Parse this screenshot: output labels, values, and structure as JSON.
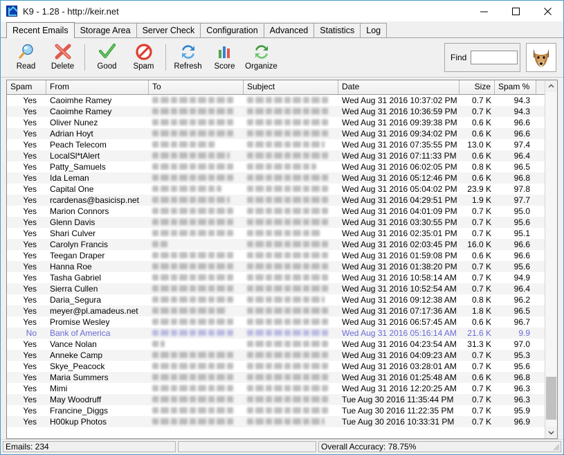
{
  "window": {
    "title": "K9 - 1.28 - http://keir.net",
    "icon": "k9-app-icon",
    "minimize_label": "Minimize",
    "maximize_label": "Maximize",
    "close_label": "Close"
  },
  "tabs": [
    {
      "label": "Recent Emails",
      "active": true
    },
    {
      "label": "Storage Area",
      "active": false
    },
    {
      "label": "Server Check",
      "active": false
    },
    {
      "label": "Configuration",
      "active": false
    },
    {
      "label": "Advanced",
      "active": false
    },
    {
      "label": "Statistics",
      "active": false
    },
    {
      "label": "Log",
      "active": false
    }
  ],
  "toolbar": {
    "buttons": [
      {
        "label": "Read",
        "icon": "magnifier-icon"
      },
      {
        "label": "Delete",
        "icon": "red-x-icon"
      },
      {
        "label": "Good",
        "icon": "green-check-icon"
      },
      {
        "label": "Spam",
        "icon": "no-entry-icon"
      },
      {
        "label": "Refresh",
        "icon": "blue-refresh-icon"
      },
      {
        "label": "Score",
        "icon": "bar-chart-icon"
      },
      {
        "label": "Organize",
        "icon": "green-refresh-icon"
      }
    ],
    "find_label": "Find",
    "find_value": "",
    "find_placeholder": "",
    "mascot_icon": "fox-head-icon"
  },
  "table": {
    "columns": [
      "Spam",
      "From",
      "To",
      "Subject",
      "Date",
      "Size",
      "Spam %"
    ],
    "rows": [
      {
        "spam": "Yes",
        "from": "Caoimhe Ramey",
        "to": "",
        "subject": "",
        "date": "Wed Aug 31 2016  10:37:02 PM",
        "size": "0.7 K",
        "pct": "94.3",
        "selected": false
      },
      {
        "spam": "Yes",
        "from": "Caoimhe Ramey",
        "to": "",
        "subject": "",
        "date": "Wed Aug 31 2016  10:36:59 PM",
        "size": "0.7 K",
        "pct": "94.3",
        "selected": false
      },
      {
        "spam": "Yes",
        "from": "Oliver Nunez",
        "to": "",
        "subject": "",
        "date": "Wed Aug 31 2016  09:39:38 PM",
        "size": "0.6 K",
        "pct": "96.6",
        "selected": false
      },
      {
        "spam": "Yes",
        "from": "Adrian Hoyt",
        "to": "",
        "subject": "",
        "date": "Wed Aug 31 2016  09:34:02 PM",
        "size": "0.6 K",
        "pct": "96.6",
        "selected": false
      },
      {
        "spam": "Yes",
        "from": "Peach Telecom",
        "to": "",
        "subject": "",
        "date": "Wed Aug 31 2016  07:35:55 PM",
        "size": "13.0 K",
        "pct": "97.4",
        "selected": false
      },
      {
        "spam": "Yes",
        "from": "LocalSl*tAlert",
        "to": "",
        "subject": "",
        "date": "Wed Aug 31 2016  07:11:33 PM",
        "size": "0.6 K",
        "pct": "96.4",
        "selected": false
      },
      {
        "spam": "Yes",
        "from": "Patty_Samuels",
        "to": "",
        "subject": "",
        "date": "Wed Aug 31 2016  06:02:05 PM",
        "size": "0.8 K",
        "pct": "96.5",
        "selected": false
      },
      {
        "spam": "Yes",
        "from": "Ida Leman",
        "to": "",
        "subject": "",
        "date": "Wed Aug 31 2016  05:12:46 PM",
        "size": "0.6 K",
        "pct": "96.8",
        "selected": false
      },
      {
        "spam": "Yes",
        "from": "Capital One",
        "to": "",
        "subject": "",
        "date": "Wed Aug 31 2016  05:04:02 PM",
        "size": "23.9 K",
        "pct": "97.8",
        "selected": false
      },
      {
        "spam": "Yes",
        "from": "rcardenas@basicisp.net",
        "to": "",
        "subject": "",
        "date": "Wed Aug 31 2016  04:29:51 PM",
        "size": "1.9 K",
        "pct": "97.7",
        "selected": false
      },
      {
        "spam": "Yes",
        "from": "Marion Connors",
        "to": "",
        "subject": "",
        "date": "Wed Aug 31 2016  04:01:09 PM",
        "size": "0.7 K",
        "pct": "95.0",
        "selected": false
      },
      {
        "spam": "Yes",
        "from": "Glenn Davis",
        "to": "",
        "subject": "",
        "date": "Wed Aug 31 2016  03:30:55 PM",
        "size": "0.7 K",
        "pct": "95.6",
        "selected": false
      },
      {
        "spam": "Yes",
        "from": "Shari Culver",
        "to": "",
        "subject": "",
        "date": "Wed Aug 31 2016  02:35:01 PM",
        "size": "0.7 K",
        "pct": "95.1",
        "selected": false
      },
      {
        "spam": "Yes",
        "from": "Carolyn Francis",
        "to": "",
        "subject": "",
        "date": "Wed Aug 31 2016  02:03:45 PM",
        "size": "16.0 K",
        "pct": "96.6",
        "selected": false
      },
      {
        "spam": "Yes",
        "from": "Teegan Draper",
        "to": "",
        "subject": "",
        "date": "Wed Aug 31 2016  01:59:08 PM",
        "size": "0.6 K",
        "pct": "96.6",
        "selected": false
      },
      {
        "spam": "Yes",
        "from": "Hanna Roe",
        "to": "",
        "subject": "",
        "date": "Wed Aug 31 2016  01:38:20 PM",
        "size": "0.7 K",
        "pct": "95.6",
        "selected": false
      },
      {
        "spam": "Yes",
        "from": "Tasha Gabriel",
        "to": "",
        "subject": "",
        "date": "Wed Aug 31 2016  10:58:14 AM",
        "size": "0.7 K",
        "pct": "94.9",
        "selected": false
      },
      {
        "spam": "Yes",
        "from": "Sierra Cullen",
        "to": "",
        "subject": "",
        "date": "Wed Aug 31 2016  10:52:54 AM",
        "size": "0.7 K",
        "pct": "96.4",
        "selected": false
      },
      {
        "spam": "Yes",
        "from": "Daria_Segura",
        "to": "",
        "subject": "",
        "date": "Wed Aug 31 2016  09:12:38 AM",
        "size": "0.8 K",
        "pct": "96.2",
        "selected": false
      },
      {
        "spam": "Yes",
        "from": "meyer@pl.amadeus.net",
        "to": "",
        "subject": "",
        "date": "Wed Aug 31 2016  07:17:36 AM",
        "size": "1.8 K",
        "pct": "96.5",
        "selected": false
      },
      {
        "spam": "Yes",
        "from": "Promise Wesley",
        "to": "",
        "subject": "",
        "date": "Wed Aug 31 2016  06:57:45 AM",
        "size": "0.6 K",
        "pct": "96.7",
        "selected": false
      },
      {
        "spam": "No",
        "from": "Bank of America",
        "to": "",
        "subject": "",
        "date": "Wed Aug 31 2016  05:16:14 AM",
        "size": "21.6 K",
        "pct": "9.9",
        "selected": true
      },
      {
        "spam": "Yes",
        "from": "Vance Nolan",
        "to": "",
        "subject": "",
        "date": "Wed Aug 31 2016  04:23:54 AM",
        "size": "31.3 K",
        "pct": "97.0",
        "selected": false
      },
      {
        "spam": "Yes",
        "from": "Anneke Camp",
        "to": "",
        "subject": "",
        "date": "Wed Aug 31 2016  04:09:23 AM",
        "size": "0.7 K",
        "pct": "95.3",
        "selected": false
      },
      {
        "spam": "Yes",
        "from": "Skye_Peacock",
        "to": "",
        "subject": "",
        "date": "Wed Aug 31 2016  03:28:01 AM",
        "size": "0.7 K",
        "pct": "95.6",
        "selected": false
      },
      {
        "spam": "Yes",
        "from": "Maria Summers",
        "to": "",
        "subject": "",
        "date": "Wed Aug 31 2016  01:25:48 AM",
        "size": "0.6 K",
        "pct": "96.8",
        "selected": false
      },
      {
        "spam": "Yes",
        "from": "Mimi",
        "to": "",
        "subject": "",
        "date": "Wed Aug 31 2016  12:20:25 AM",
        "size": "0.7 K",
        "pct": "96.3",
        "selected": false
      },
      {
        "spam": "Yes",
        "from": "May Woodruff",
        "to": "",
        "subject": "",
        "date": "Tue Aug 30 2016  11:35:44 PM",
        "size": "0.7 K",
        "pct": "96.3",
        "selected": false
      },
      {
        "spam": "Yes",
        "from": "Francine_Diggs",
        "to": "",
        "subject": "",
        "date": "Tue Aug 30 2016  11:22:35 PM",
        "size": "0.7 K",
        "pct": "95.9",
        "selected": false
      },
      {
        "spam": "Yes",
        "from": "H00kup Photos",
        "to": "",
        "subject": "",
        "date": "Tue Aug 30 2016  10:33:31 PM",
        "size": "0.7 K",
        "pct": "96.9",
        "selected": false
      }
    ]
  },
  "scrollbar": {
    "up_icon": "chevron-up-icon",
    "down_icon": "chevron-down-icon"
  },
  "statusbar": {
    "emails": "Emails: 234",
    "middle": "",
    "accuracy": "Overall Accuracy: 78.75%"
  },
  "colors": {
    "selected_text": "#6a6ad6",
    "window_border": "#4a9bc4",
    "chrome": "#f0f0f0"
  }
}
